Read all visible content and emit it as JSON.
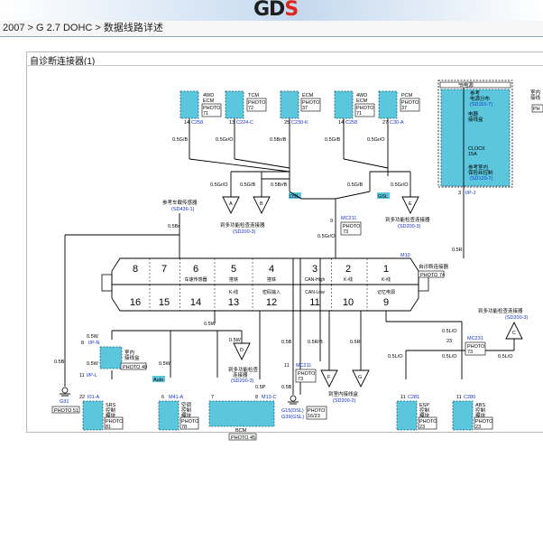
{
  "header": {
    "logo_main": "GD",
    "logo_accent": "S",
    "breadcrumb": "2007 > G 2.7 DOHC > 数据线路详述"
  },
  "panel": {
    "title": "自诊断连接器(1)"
  },
  "top_components": [
    {
      "id": "4wd-ecm",
      "name": "4WD\nECM",
      "photo": "PHOTO\n71",
      "pin": "14",
      "conn": "C258",
      "wire": "0.5G/B"
    },
    {
      "id": "tcm",
      "name": "TCM",
      "photo": "PHOTO\n72",
      "pin": "13",
      "conn": "C224-C",
      "wire": "0.5Gr/O"
    },
    {
      "id": "ecm",
      "name": "ECM",
      "photo": "PHOTO\n37",
      "pin": "25",
      "conn": "C230-K",
      "wire": "0.5Br/B"
    },
    {
      "id": "4wd-ecm-2",
      "name": "4WD\nECM",
      "photo": "PHOTO\n71",
      "pin": "14",
      "conn": "C258",
      "wire": "0.5G/B"
    },
    {
      "id": "pcm",
      "name": "PCM",
      "photo": "PHOTO\n37",
      "pin": "27",
      "conn": "C30-A",
      "wire": "0.5Gr/O"
    }
  ],
  "power_box": {
    "title": "*B电源",
    "label1": "参考\n电源分布",
    "ref1": "(SD110-7)",
    "fuse_box": "电器\n接线盒",
    "fuse_name": "CLOCK\n15A",
    "label2": "参考室内\n保险丝控制",
    "ref2": "(SD120-7)",
    "side_label": "室内\n接线",
    "side_photo": "PH",
    "pin": "3",
    "conn": "I/P-J"
  },
  "labels": {
    "ref_left": "参考车载传感器",
    "ref_left_code": "(SD436-1)",
    "wire_05br": "0.5Br",
    "dsl": "DSL",
    "gsl": "GSL",
    "multi_ref": "到多功能检查连接器",
    "multi_ref_code": "(SD200-3)",
    "mc211_pin": "9",
    "mc211": "MC211",
    "mc211_photo": "PHOTO\n73",
    "wire_05gro_mid": "0.5Gr/O",
    "wire_05r": "0.5R",
    "m10": "M10",
    "diag_conn": "自诊断连接器",
    "diag_photo": "PHOTO 74",
    "wire_05g_b_a": "0.5G/B",
    "wire_05gro_a": "0.5Gr/O",
    "wire_05brb_a": "0.5Br/B",
    "wire_05g_b_b": "0.5G/B",
    "wire_05gro_b": "0.5Gr/O"
  },
  "connector": {
    "top_pins": [
      {
        "n": "8",
        "label": ""
      },
      {
        "n": "7",
        "label": ""
      },
      {
        "n": "6",
        "label": "车速传感器"
      },
      {
        "n": "5",
        "label": "搭铁"
      },
      {
        "n": "4",
        "label": "搭铁"
      },
      {
        "n": "3",
        "label": "CAN-High"
      },
      {
        "n": "2",
        "label": "K-线"
      },
      {
        "n": "1",
        "label": "K-线"
      }
    ],
    "bottom_pins": [
      {
        "n": "16",
        "label": ""
      },
      {
        "n": "15",
        "label": ""
      },
      {
        "n": "14",
        "label": ""
      },
      {
        "n": "13",
        "label": "K-线"
      },
      {
        "n": "12",
        "label": "密码输入"
      },
      {
        "n": "11",
        "label": "CAN-Low"
      },
      {
        "n": "10",
        "label": ""
      },
      {
        "n": "9",
        "label": "记忆电源"
      }
    ]
  },
  "bottom": {
    "g31": "G31",
    "g31_photo": "PHOTO 51",
    "w_05b": "0.5B",
    "ip_n_pin": "8",
    "ip_n": "I/P-N",
    "ip_box": "室内\n接线盒",
    "ip_photo": "PHOTO 49",
    "ip_l_pin": "11",
    "ip_l": "I/P-L",
    "w_05w_a": "0.5W",
    "w_05w_b": "0.5W",
    "w_05w_c": "0.5W",
    "w_05w_d": "0.5W",
    "w_05w_e": "0.5W",
    "i01_pin": "22",
    "i01": "I01-A",
    "srs": "SRS\n控制\n模块",
    "srs_photo": "PHOTO\n81",
    "auto": "Auto",
    "m41_pin": "6",
    "m41": "M41-A",
    "ac": "空调\n控制\n模块",
    "ac_photo": "PHOTO\n78",
    "bcm_pin": "7",
    "bcm_pin2": "8",
    "m13": "M13-C",
    "bcm": "BCM",
    "bcm_photo": "PHOTO 45",
    "w_05p": "0.5P",
    "w_05b2": "0.5B",
    "w_05b3": "0.5B",
    "d_label": "到多功能检查\n连接器",
    "d_code": "(SD200-3)",
    "g15": "G15(DSL)",
    "g39": "G39(GSL)",
    "g_photo": "PHOTO\n16/23",
    "mc211b_pin": "11",
    "mc211b": "MC211",
    "mc211b_photo": "PHOTO\n73",
    "w_05rb": "0.5R/B",
    "w_05r": "0.5R",
    "fg_label": "到室内接线盒",
    "fg_code": "(SD200-2)",
    "w_05lo_a": "0.5L/O",
    "w_05lo_b": "0.5L/O",
    "w_05lo_c": "0.5L/O",
    "w_05lo_d": "0.5L/O",
    "w_05lo_e": "0.5L/O",
    "mc231_pin": "23",
    "mc231": "MC231",
    "mc231_photo": "PHOTO\n73",
    "c_label": "到多功能检查连接器",
    "c_code": "(SD200-3)",
    "c281_pin": "11",
    "c281": "C281",
    "esp": "ESP\n控制\n模块",
    "esp_photo": "PHOTO\n23",
    "c280_pin": "11",
    "c280": "C280",
    "abs": "ABS\n控制\n模块",
    "abs_photo": "PHOTO\n23"
  },
  "colors": {
    "module_fill": "#5cc6dd",
    "wire": "#000000",
    "link_blue": "#1533c8",
    "accent_red": "#e0251b"
  }
}
